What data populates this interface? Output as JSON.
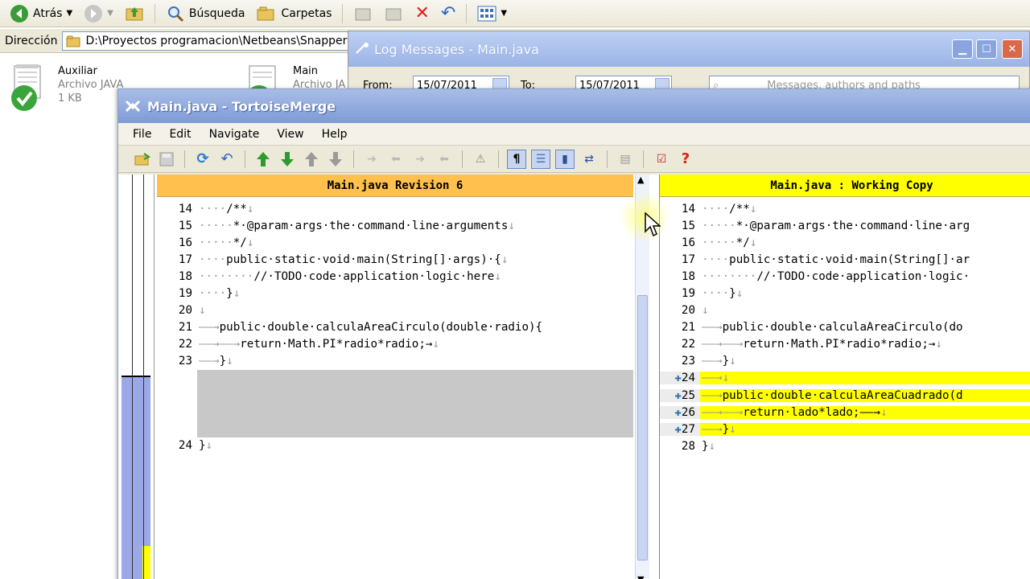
{
  "explorer": {
    "toolbar": {
      "back_label": "Atrás",
      "search_label": "Búsqueda",
      "folders_label": "Carpetas"
    },
    "address": {
      "label": "Dirección",
      "path": "D:\\Proyectos programacion\\Netbeans\\SnapperChain"
    },
    "files": [
      {
        "name": "Auxiliar",
        "type": "Archivo JAVA",
        "size": "1 KB"
      },
      {
        "name": "Main",
        "type": "Archivo JA"
      }
    ]
  },
  "log_window": {
    "title": "Log Messages - Main.java",
    "from_label": "From:",
    "from_value": "15/07/2011",
    "to_label": "To:",
    "to_value": "15/07/2011",
    "search_placeholder": "Messages, authors and paths"
  },
  "merge_window": {
    "title": "Main.java - TortoiseMerge",
    "menu": [
      "File",
      "Edit",
      "Navigate",
      "View",
      "Help"
    ],
    "left_pane": {
      "header": "Main.java Revision 6",
      "lines": [
        {
          "n": "14",
          "ws": "····",
          "code": "/**",
          "end": "↓"
        },
        {
          "n": "15",
          "ws": "·····",
          "code": "*·@param·args·the·command·line·arguments",
          "end": "↓"
        },
        {
          "n": "16",
          "ws": "·····",
          "code": "*/",
          "end": "↓"
        },
        {
          "n": "17",
          "ws": "····",
          "code": "public·static·void·main(String[]·args)·{",
          "end": "↓"
        },
        {
          "n": "18",
          "ws": "········",
          "code": "//·TODO·code·application·logic·here",
          "end": "↓"
        },
        {
          "n": "19",
          "ws": "····",
          "code": "}",
          "end": "↓"
        },
        {
          "n": "20",
          "ws": "",
          "code": "",
          "end": "↓"
        },
        {
          "n": "21",
          "ws": "——→",
          "code": "public·double·calculaAreaCirculo(double·radio){",
          "end": ""
        },
        {
          "n": "22",
          "ws": "——→——→",
          "code": "return·Math.PI*radio*radio;→",
          "end": "↓"
        },
        {
          "n": "23",
          "ws": "——→",
          "code": "}",
          "end": "↓"
        },
        {
          "n": "24",
          "ws": "",
          "code": "}",
          "end": "↓"
        }
      ]
    },
    "right_pane": {
      "header": "Main.java : Working Copy",
      "lines": [
        {
          "n": "14",
          "ws": "····",
          "code": "/**",
          "end": "↓"
        },
        {
          "n": "15",
          "ws": "·····",
          "code": "*·@param·args·the·command·line·arg",
          "end": ""
        },
        {
          "n": "16",
          "ws": "·····",
          "code": "*/",
          "end": "↓"
        },
        {
          "n": "17",
          "ws": "····",
          "code": "public·static·void·main(String[]·ar",
          "end": ""
        },
        {
          "n": "18",
          "ws": "········",
          "code": "//·TODO·code·application·logic·",
          "end": ""
        },
        {
          "n": "19",
          "ws": "····",
          "code": "}",
          "end": "↓"
        },
        {
          "n": "20",
          "ws": "",
          "code": "",
          "end": "↓"
        },
        {
          "n": "21",
          "ws": "——→",
          "code": "public·double·calculaAreaCirculo(do",
          "end": ""
        },
        {
          "n": "22",
          "ws": "——→——→",
          "code": "return·Math.PI*radio*radio;→",
          "end": "↓"
        },
        {
          "n": "23",
          "ws": "——→",
          "code": "}",
          "end": "↓"
        },
        {
          "n": "24",
          "ws": "——→",
          "code": "",
          "end": "↓",
          "added": true
        },
        {
          "n": "25",
          "ws": "——→",
          "code": "public·double·calculaAreaCuadrado(d",
          "end": "",
          "added": true
        },
        {
          "n": "26",
          "ws": "——→——→",
          "code": "return·lado*lado;——→",
          "end": "↓",
          "added": true
        },
        {
          "n": "27",
          "ws": "——→",
          "code": "}",
          "end": "↓",
          "added": true
        },
        {
          "n": "28",
          "ws": "",
          "code": "}",
          "end": "↓"
        }
      ]
    }
  },
  "colors": {
    "left_header": "#ffc04d",
    "right_header": "#ffff00",
    "added_line": "#ffff00",
    "removed_block": "#c8c8c8",
    "locator_blue": "#9aa8e8"
  }
}
